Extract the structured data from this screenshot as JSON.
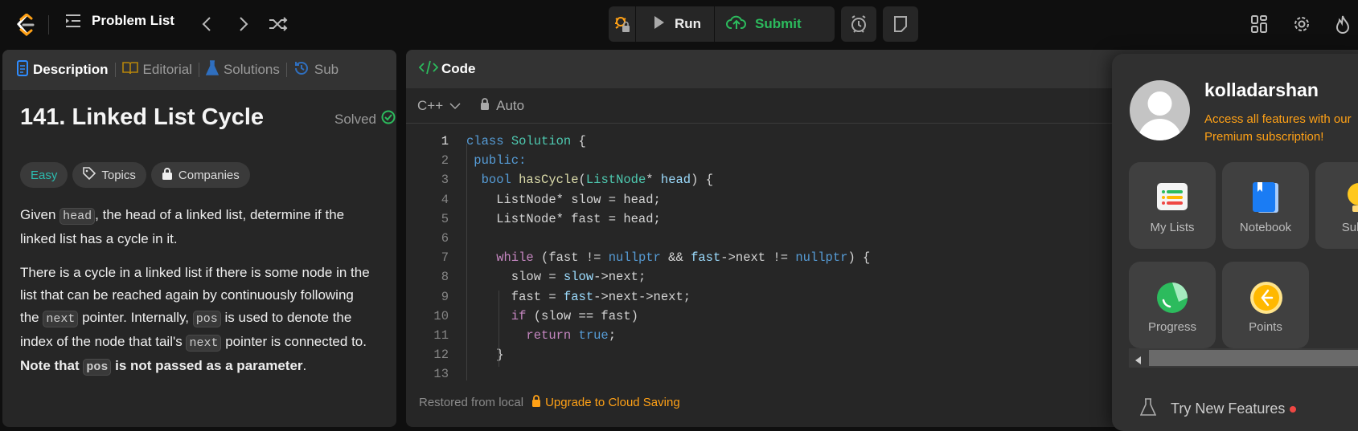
{
  "topbar": {
    "title": "Problem List",
    "run_label": "Run",
    "submit_label": "Submit"
  },
  "colors": {
    "accent_orange": "#ffa116",
    "green": "#2cbb5d",
    "easy": "#2cbcb0"
  },
  "description_panel": {
    "tabs": [
      {
        "label": "Description"
      },
      {
        "label": "Editorial"
      },
      {
        "label": "Solutions"
      },
      {
        "label": "Sub"
      }
    ],
    "title": "141. Linked List Cycle",
    "status": "Solved",
    "difficulty": "Easy",
    "topics_label": "Topics",
    "companies_label": "Companies",
    "paragraphs": [
      [
        {
          "t": "Given "
        },
        {
          "t": "head",
          "code": true
        },
        {
          "t": ", the head of a linked list, determine if the linked list has a cycle in it."
        }
      ],
      [
        {
          "t": "There is a cycle in a linked list if there is some node in the list that can be reached again by continuously following the "
        },
        {
          "t": "next",
          "code": true
        },
        {
          "t": " pointer. Internally, "
        },
        {
          "t": "pos",
          "code": true
        },
        {
          "t": " is used to denote the index of the node that tail's "
        },
        {
          "t": "next",
          "code": true
        },
        {
          "t": " pointer is connected to. "
        },
        {
          "t": "Note that ",
          "b": true
        },
        {
          "t": "pos",
          "code": true,
          "b": true
        },
        {
          "t": " is not passed as a parameter",
          "b": true
        },
        {
          "t": "."
        }
      ]
    ]
  },
  "code_panel": {
    "tab_label": "Code",
    "language": "C++",
    "mode": "Auto",
    "footer_status": "Restored from local",
    "footer_upgrade": "Upgrade to Cloud Saving",
    "lines": [
      {
        "n": "1",
        "tok": [
          [
            "class ",
            "kw"
          ],
          [
            "Solution ",
            "ty"
          ],
          [
            "{",
            "pl"
          ]
        ]
      },
      {
        "n": "2",
        "tok": [
          [
            " public:",
            "kw"
          ]
        ]
      },
      {
        "n": "3",
        "tok": [
          [
            "  bool ",
            "kw"
          ],
          [
            "hasCycle",
            "fn"
          ],
          [
            "(",
            "pl"
          ],
          [
            "ListNode",
            "ty"
          ],
          [
            "* ",
            "pl"
          ],
          [
            "head",
            "va"
          ],
          [
            ") {",
            "pl"
          ]
        ]
      },
      {
        "n": "4",
        "tok": [
          [
            "    ListNode* slow = head;",
            "pl"
          ]
        ]
      },
      {
        "n": "5",
        "tok": [
          [
            "    ListNode* fast = head;",
            "pl"
          ]
        ]
      },
      {
        "n": "6",
        "tok": []
      },
      {
        "n": "7",
        "tok": [
          [
            "    while ",
            "ct"
          ],
          [
            "(fast != ",
            "pl"
          ],
          [
            "nullptr",
            "kw"
          ],
          [
            " && ",
            "pl"
          ],
          [
            "fast",
            "va"
          ],
          [
            "->next != ",
            "pl"
          ],
          [
            "nullptr",
            "kw"
          ],
          [
            ") {",
            "pl"
          ]
        ]
      },
      {
        "n": "8",
        "tok": [
          [
            "      slow = ",
            "pl"
          ],
          [
            "slow",
            "va"
          ],
          [
            "->next;",
            "pl"
          ]
        ]
      },
      {
        "n": "9",
        "tok": [
          [
            "      fast = ",
            "pl"
          ],
          [
            "fast",
            "va"
          ],
          [
            "->next->next;",
            "pl"
          ]
        ]
      },
      {
        "n": "10",
        "tok": [
          [
            "      if ",
            "ct"
          ],
          [
            "(slow == fast)",
            "pl"
          ]
        ]
      },
      {
        "n": "11",
        "tok": [
          [
            "        return ",
            "ct"
          ],
          [
            "true",
            "kw"
          ],
          [
            ";",
            "pl"
          ]
        ]
      },
      {
        "n": "12",
        "tok": [
          [
            "    }",
            "pl"
          ]
        ]
      },
      {
        "n": "13",
        "tok": []
      }
    ]
  },
  "user_menu": {
    "username": "kolladarshan",
    "premium_line1": "Access all features with our",
    "premium_line2": "Premium subscription!",
    "cards": [
      {
        "label": "My Lists"
      },
      {
        "label": "Notebook"
      },
      {
        "label": "Submi"
      },
      {
        "label": "Progress"
      },
      {
        "label": "Points"
      }
    ],
    "try_new_features": "Try New Features"
  }
}
